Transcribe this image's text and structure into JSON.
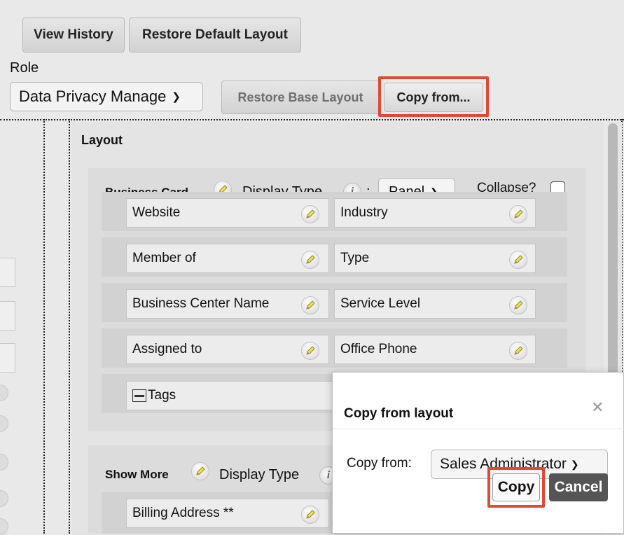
{
  "toolbar": {
    "view_history": "View History",
    "restore_default": "Restore Default Layout"
  },
  "role": {
    "label": "Role",
    "selected": "Data Privacy Manage"
  },
  "actions": {
    "restore_base": "Restore Base Layout",
    "copy_from": "Copy from..."
  },
  "layout": {
    "title": "Layout",
    "business_card": {
      "title": "Business Card",
      "display_type_label": "Display Type",
      "colon": ":",
      "display_type_value": "Panel",
      "collapse_label": "Collapse?",
      "collapse_checked": false,
      "rows": [
        [
          "Website",
          "Industry"
        ],
        [
          "Member of",
          "Type"
        ],
        [
          "Business Center Name",
          "Service Level"
        ],
        [
          "Assigned to",
          "Office Phone"
        ],
        [
          "Tags"
        ]
      ]
    },
    "show_more": {
      "title": "Show More",
      "display_type_label": "Display Type",
      "first_field": "Billing Address **"
    }
  },
  "dialog": {
    "title": "Copy from layout",
    "close_icon": "close-icon",
    "copy_from_label": "Copy from:",
    "copy_from_value": "Sales Administrator",
    "copy_button": "Copy",
    "cancel_button": "Cancel"
  },
  "colors": {
    "highlight": "#e04a34",
    "cancel_bg": "#555555"
  }
}
